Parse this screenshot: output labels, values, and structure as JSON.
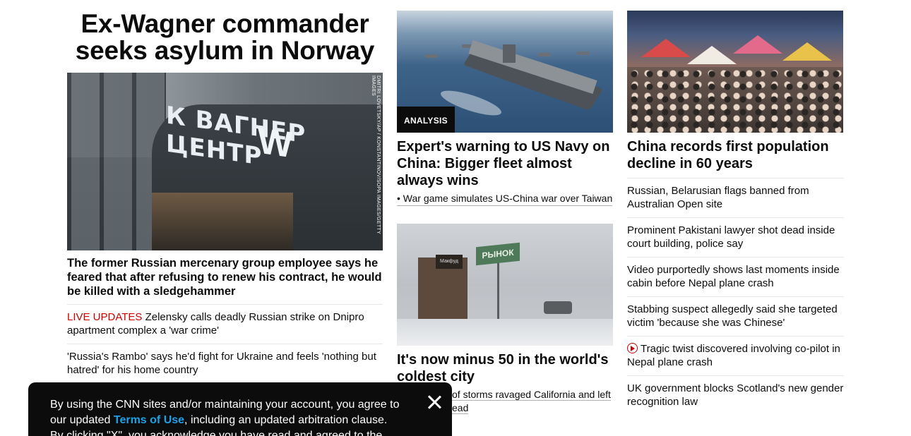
{
  "lead": {
    "headline": "Ex-Wagner commander seeks asylum in Norway",
    "image_credit": "Dmitri Lovetsky/AP / Konstantinov/SOPA Images/Getty Images",
    "image_sign_text": "К ВАГНЕР ЦЕНТР",
    "image_logo_text": "W",
    "summary": "The former Russian mercenary group employee says he feared that after refusing to renew his contract, he would be killed with a sledgehammer",
    "related": [
      {
        "tag": "LIVE UPDATES",
        "text": " Zelensky calls deadly Russian strike on Dnipro apartment complex a 'war crime'"
      },
      {
        "tag": "",
        "text": "'Russia's Rambo' says he'd fight for Ukraine and feels 'nothing but hatred' for his home country"
      }
    ]
  },
  "middle": {
    "card1": {
      "badge": "ANALYSIS",
      "headline": "Expert's warning to US Navy on China: Bigger fleet almost always wins",
      "bullet": "• War game simulates US-China war over Taiwan"
    },
    "card2": {
      "image_sign_text": "РЫНОК",
      "image_kiosk_text": "Макфуд",
      "headline": "It's now minus 50 in the world's coldest city",
      "bullet_visible": "of storms ravaged California and left",
      "bullet_line2": "ead"
    }
  },
  "right": {
    "headline": "China records first population decline in 60 years",
    "stories": [
      {
        "video": false,
        "text": "Russian, Belarusian flags banned from Australian Open site"
      },
      {
        "video": false,
        "text": "Prominent Pakistani lawyer shot dead inside court building, police say"
      },
      {
        "video": false,
        "text": "Video purportedly shows last moments inside cabin before Nepal plane crash"
      },
      {
        "video": false,
        "text": "Stabbing suspect allegedly said she targeted victim 'because she was Chinese'"
      },
      {
        "video": true,
        "text": "Tragic twist discovered involving co-pilot in Nepal plane crash"
      },
      {
        "video": false,
        "text": "UK government blocks Scotland's new gender recognition law"
      }
    ]
  },
  "consent": {
    "line1": "By using the CNN sites and/or maintaining your account, you agree to",
    "line2_pre": "our updated ",
    "terms_link": "Terms of Use",
    "line2_post": ", including an updated arbitration clause.",
    "line3": "By clicking \"X\", you acknowledge you have read and agreed to the"
  },
  "colors": {
    "live": "#cc0000",
    "link": "#1fa1e8",
    "badge_bg": "#0c0c0c"
  },
  "icons": [
    "play-icon",
    "close-icon"
  ]
}
